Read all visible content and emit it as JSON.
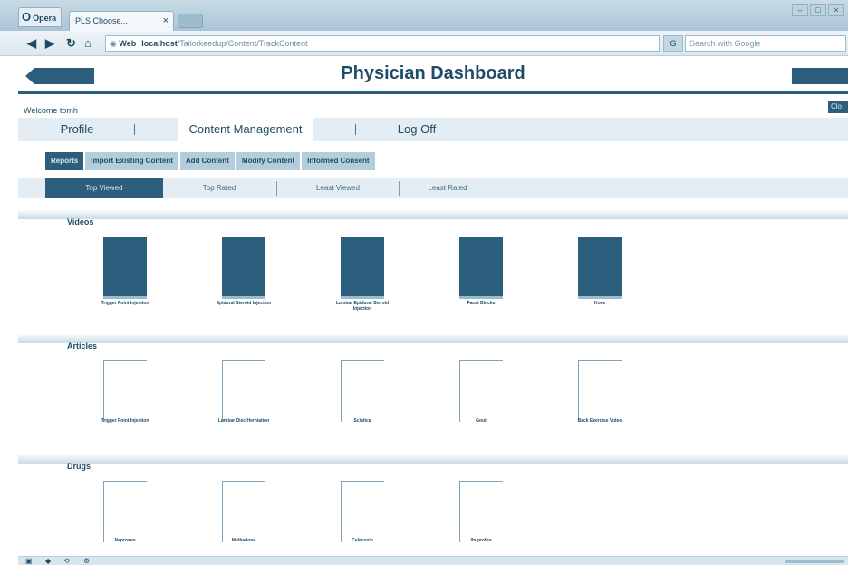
{
  "browser": {
    "menu_label": "Opera",
    "tab_title": "PLS Choose...",
    "tab_close": "×",
    "url_badge": "Web",
    "url_host": "localhost",
    "url_path": "/Tailorkeedup/Content/TrackContent",
    "search_engine": "G",
    "search_placeholder": "Search with Google"
  },
  "header": {
    "back_label": "",
    "title": "Physician Dashboard",
    "right_label": ""
  },
  "welcome": "Welcome tomh",
  "close_label": "Clo",
  "main_nav": {
    "profile": "Profile",
    "content": "Content Management",
    "logoff": "Log Off"
  },
  "sub_nav": [
    "Reports",
    "Import Existing Content",
    "Add Content",
    "Modify Content",
    "Informed Consent"
  ],
  "filters": [
    "Top Viewed",
    "Top Rated",
    "Least Viewed",
    "Least Rated"
  ],
  "sections": {
    "videos": {
      "label": "Videos",
      "items": [
        {
          "caption": "Trigger Point Injection"
        },
        {
          "caption": "Epidural Steroid Injection"
        },
        {
          "caption": "Lumbar Epidural Steroid Injection"
        },
        {
          "caption": "Facet Blocks"
        },
        {
          "caption": "Knee"
        }
      ]
    },
    "articles": {
      "label": "Articles",
      "items": [
        {
          "caption": "Trigger Point Injection"
        },
        {
          "caption": "Lumbar Disc Herniation"
        },
        {
          "caption": "Sciatica"
        },
        {
          "caption": "Gout"
        },
        {
          "caption": "Back Exercise Video"
        }
      ]
    },
    "drugs": {
      "label": "Drugs",
      "items": [
        {
          "caption": "Naproxen"
        },
        {
          "caption": "Methadone"
        },
        {
          "caption": "Celecoxib"
        },
        {
          "caption": "Ibuprofen"
        }
      ]
    }
  },
  "icons": {
    "back": "arrow-left-icon",
    "forward": "arrow-right-icon",
    "reload": "reload-icon",
    "home": "home-icon",
    "security": "globe-icon"
  }
}
